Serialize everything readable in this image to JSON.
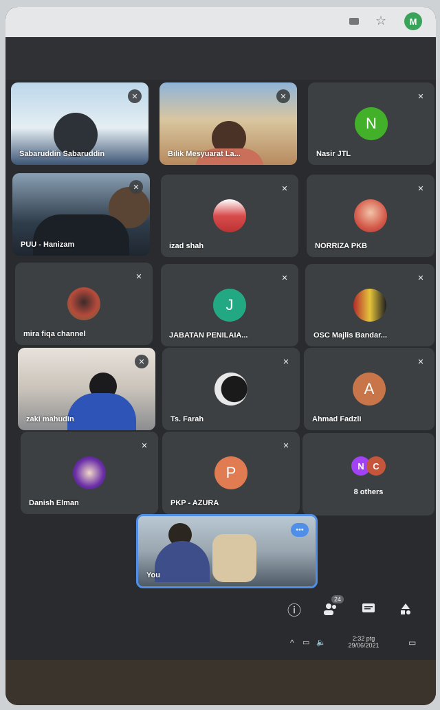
{
  "browser": {
    "profile_initial": "M",
    "star_icon": "star-icon"
  },
  "participants": [
    {
      "id": "p1",
      "name": "Sabaruddin Sabaruddin",
      "type": "video"
    },
    {
      "id": "p2",
      "name": "Bilik Mesyuarat La...",
      "type": "video"
    },
    {
      "id": "p3",
      "name": "Nasir JTL",
      "type": "avatar",
      "initial": "N",
      "color": "#43b02a"
    },
    {
      "id": "p4",
      "name": "PUU - Hanizam",
      "type": "video"
    },
    {
      "id": "p5",
      "name": "izad shah",
      "type": "photo"
    },
    {
      "id": "p6",
      "name": "NORRIZA PKB",
      "type": "photo"
    },
    {
      "id": "p7",
      "name": "mira fiqa channel",
      "type": "photo"
    },
    {
      "id": "p8",
      "name": "JABATAN PENILAIA...",
      "type": "avatar",
      "initial": "J",
      "color": "#23a884"
    },
    {
      "id": "p9",
      "name": "OSC Majlis Bandar...",
      "type": "photo"
    },
    {
      "id": "p10",
      "name": "zaki mahudin",
      "type": "video"
    },
    {
      "id": "p11",
      "name": "Ts. Farah",
      "type": "photo"
    },
    {
      "id": "p12",
      "name": "Ahmad Fadzli",
      "type": "avatar",
      "initial": "A",
      "color": "#c8754a"
    },
    {
      "id": "p13",
      "name": "Danish Elman",
      "type": "photo"
    },
    {
      "id": "p14",
      "name": "PKP - AZURA",
      "type": "avatar",
      "initial": "P",
      "color": "#e07b52"
    }
  ],
  "others": {
    "label": "8 others",
    "initials": [
      {
        "initial": "N",
        "color": "#a142f4"
      },
      {
        "initial": "C",
        "color": "#c5553b"
      }
    ]
  },
  "self_tile": {
    "label": "You"
  },
  "controls": {
    "people_count": "24"
  },
  "taskbar": {
    "time": "2:32 ptg",
    "date": "29/06/2021"
  }
}
